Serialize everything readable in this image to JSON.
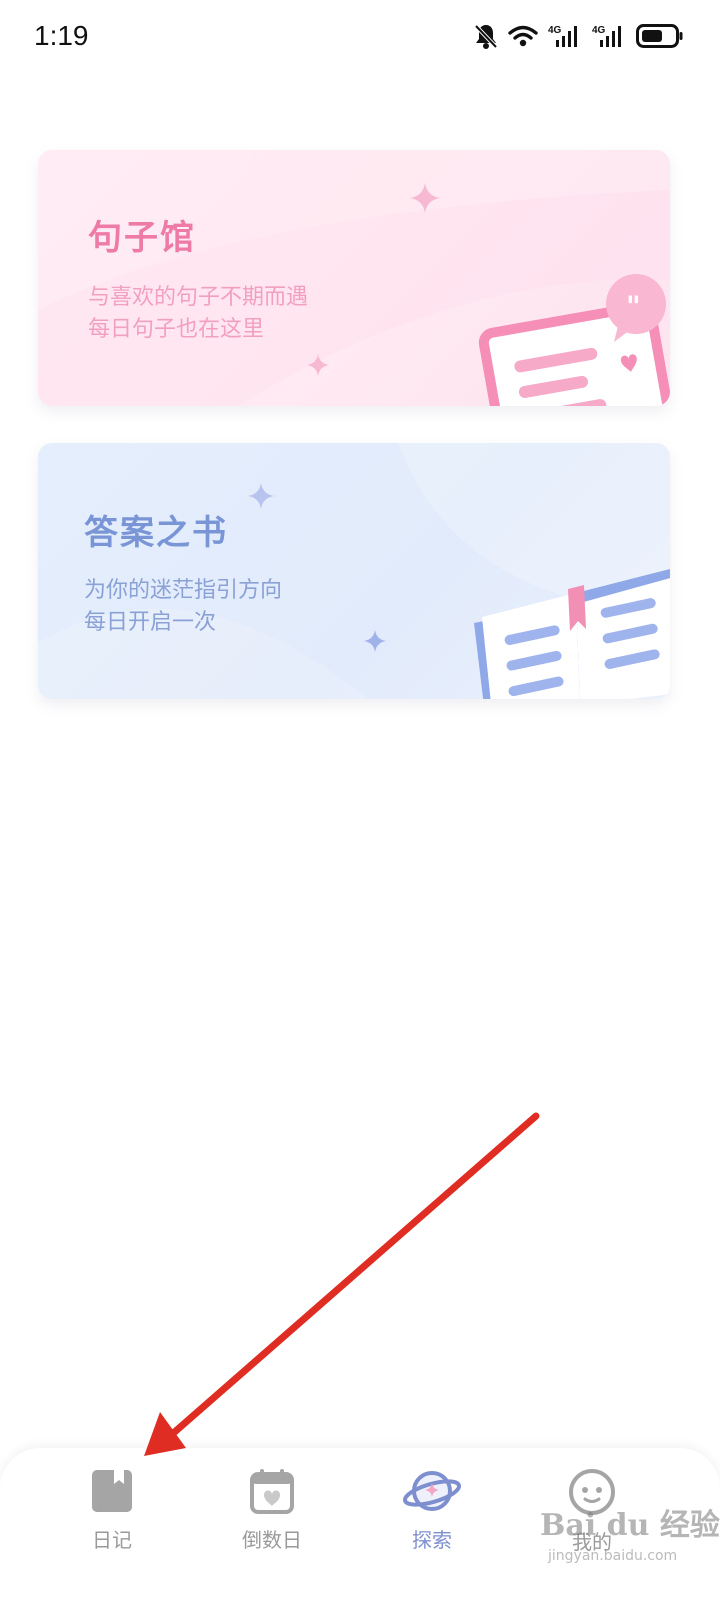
{
  "status_bar": {
    "time": "1:19",
    "icons": [
      "bell-muted-icon",
      "wifi-icon",
      "signal-4g-icon",
      "signal-4g-icon",
      "battery-icon"
    ],
    "network_labels": [
      "4G",
      "4G"
    ]
  },
  "cards": [
    {
      "title": "句子馆",
      "subtitle_line1": "与喜欢的句子不期而遇",
      "subtitle_line2": "每日句子也在这里",
      "accent": "#ee7ba6"
    },
    {
      "title": "答案之书",
      "subtitle_line1": "为你的迷茫指引方向",
      "subtitle_line2": "每日开启一次",
      "accent": "#7995d6"
    }
  ],
  "bottom_nav": {
    "items": [
      {
        "label": "日记",
        "icon": "diary-book-icon",
        "active": false
      },
      {
        "label": "倒数日",
        "icon": "calendar-heart-icon",
        "active": false
      },
      {
        "label": "探索",
        "icon": "planet-icon",
        "active": true
      },
      {
        "label": "我的",
        "icon": "profile-face-icon",
        "active": false
      }
    ]
  },
  "watermark": {
    "text": "Bai du 经验",
    "sub": "jingyan.baidu.com"
  },
  "annotation": {
    "color": "#e02d24"
  }
}
